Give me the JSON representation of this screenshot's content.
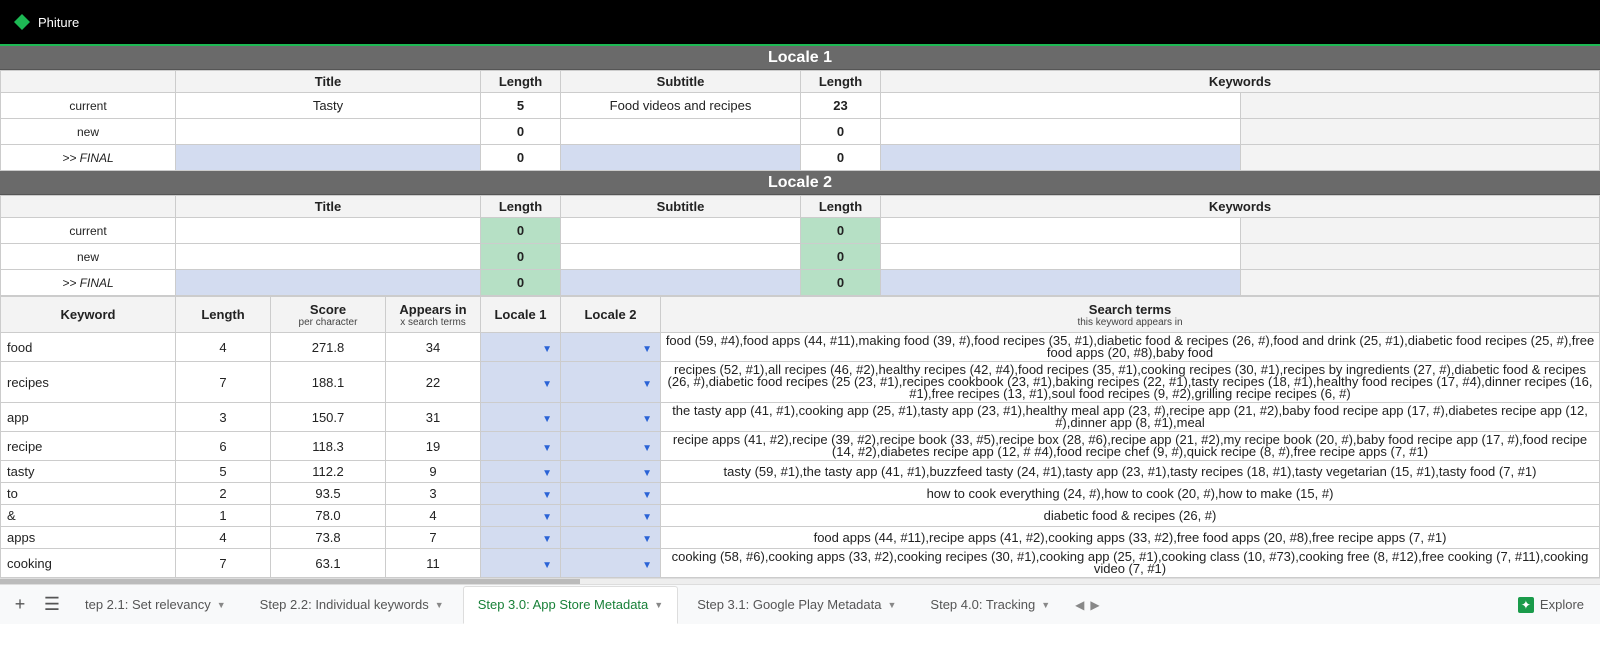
{
  "topbar": {
    "brand": "Phiture"
  },
  "locale1": {
    "header": "Locale 1",
    "cols": {
      "title": "Title",
      "len1": "Length",
      "subtitle": "Subtitle",
      "len2": "Length",
      "keywords": "Keywords"
    },
    "rows": [
      {
        "label": "current",
        "title": "Tasty",
        "len1": "5",
        "subtitle": "Food videos and recipes",
        "len2": "23",
        "kw": ""
      },
      {
        "label": "new",
        "title": "",
        "len1": "0",
        "subtitle": "",
        "len2": "0",
        "kw": ""
      },
      {
        "label": ">> FINAL",
        "title": "",
        "len1": "0",
        "subtitle": "",
        "len2": "0",
        "kw": ""
      }
    ]
  },
  "locale2": {
    "header": "Locale 2",
    "cols": {
      "title": "Title",
      "len1": "Length",
      "subtitle": "Subtitle",
      "len2": "Length",
      "keywords": "Keywords"
    },
    "rows": [
      {
        "label": "current",
        "title": "",
        "len1": "0",
        "subtitle": "",
        "len2": "0",
        "kw": ""
      },
      {
        "label": "new",
        "title": "",
        "len1": "0",
        "subtitle": "",
        "len2": "0",
        "kw": ""
      },
      {
        "label": ">> FINAL",
        "title": "",
        "len1": "0",
        "subtitle": "",
        "len2": "0",
        "kw": ""
      }
    ]
  },
  "kw_headers": {
    "keyword": "Keyword",
    "length": "Length",
    "score": "Score",
    "score_sub": "per character",
    "appears": "Appears in",
    "appears_sub": "x search terms",
    "l1": "Locale 1",
    "l2": "Locale 2",
    "terms": "Search terms",
    "terms_sub": "this keyword appears in"
  },
  "keywords": [
    {
      "kw": "food",
      "len": "4",
      "score": "271.8",
      "appears": "34",
      "terms": "food (59, #4),food apps (44, #11),making food (39, #),food recipes (35, #1),diabetic food & recipes (26, #),food and drink (25, #1),diabetic food recipes (25, #),free food apps (20, #8),baby food"
    },
    {
      "kw": "recipes",
      "len": "7",
      "score": "188.1",
      "appears": "22",
      "terms": "recipes (52, #1),all recipes (46, #2),healthy recipes (42, #4),food recipes (35, #1),cooking recipes (30, #1),recipes by ingredients (27, #),diabetic food & recipes (26, #),diabetic food recipes (25 (23, #1),recipes cookbook (23, #1),baking recipes (22, #1),tasty recipes (18, #1),healthy food recipes (17, #4),dinner recipes (16, #1),free recipes (13, #1),soul food recipes (9, #2),grilling recipe recipes (6, #)"
    },
    {
      "kw": "app",
      "len": "3",
      "score": "150.7",
      "appears": "31",
      "terms": "the tasty app (41, #1),cooking app (25, #1),tasty app (23, #1),healthy meal app (23, #),recipe app (21, #2),baby food recipe app (17, #),diabetes recipe app (12, #),dinner app (8, #1),meal"
    },
    {
      "kw": "recipe",
      "len": "6",
      "score": "118.3",
      "appears": "19",
      "terms": "recipe apps (41, #2),recipe (39, #2),recipe book (33, #5),recipe box (28, #6),recipe app (21, #2),my recipe book (20, #),baby food recipe app (17, #),food recipe (14, #2),diabetes recipe app (12, # #4),food recipe chef (9, #),quick recipe (8, #),free recipe apps (7, #1)"
    },
    {
      "kw": "tasty",
      "len": "5",
      "score": "112.2",
      "appears": "9",
      "terms": "tasty (59, #1),the tasty app (41, #1),buzzfeed tasty (24, #1),tasty app (23, #1),tasty recipes (18, #1),tasty vegetarian (15, #1),tasty food (7, #1)"
    },
    {
      "kw": "to",
      "len": "2",
      "score": "93.5",
      "appears": "3",
      "terms": "how to cook everything (24, #),how to cook (20, #),how to make (15, #)"
    },
    {
      "kw": "&",
      "len": "1",
      "score": "78.0",
      "appears": "4",
      "terms": "diabetic food & recipes (26, #)"
    },
    {
      "kw": "apps",
      "len": "4",
      "score": "73.8",
      "appears": "7",
      "terms": "food apps (44, #11),recipe apps (41, #2),cooking apps (33, #2),free food apps (20, #8),free recipe apps (7, #1)"
    },
    {
      "kw": "cooking",
      "len": "7",
      "score": "63.1",
      "appears": "11",
      "terms": "cooking (58, #6),cooking apps (33, #2),cooking recipes (30, #1),cooking app (25, #1),cooking class (10, #73),cooking free (8, #12),free cooking (7, #11),cooking video (7, #1)"
    }
  ],
  "tabs": {
    "t1": "tep 2.1: Set relevancy",
    "t2": "Step 2.2: Individual keywords",
    "t3": "Step 3.0: App Store Metadata",
    "t4": "Step 3.1: Google Play Metadata",
    "t5": "Step 4.0: Tracking",
    "explore": "Explore"
  }
}
